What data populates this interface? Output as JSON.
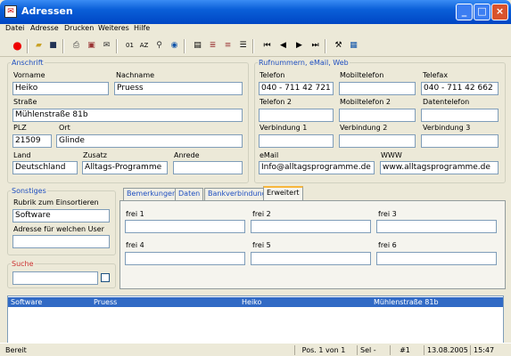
{
  "window": {
    "title": "Adressen",
    "app_icon": "address-book-icon"
  },
  "menu": [
    "Datei",
    "Adresse",
    "Drucken",
    "Weiteres",
    "Hilfe"
  ],
  "anschrift": {
    "legend": "Anschrift",
    "vorname_label": "Vorname",
    "vorname": "Heiko",
    "nachname_label": "Nachname",
    "nachname": "Pruess",
    "strasse_label": "Straße",
    "strasse": "Mühlenstraße 81b",
    "plz_label": "PLZ",
    "plz": "21509",
    "ort_label": "Ort",
    "ort": "Glinde",
    "land_label": "Land",
    "land": "Deutschland",
    "zusatz_label": "Zusatz",
    "zusatz": "Alltags-Programme",
    "anrede_label": "Anrede",
    "anrede": ""
  },
  "rufnummern": {
    "legend": "Rufnummern, eMail, Web",
    "telefon_label": "Telefon",
    "telefon": "040 - 711 42 721",
    "mobil_label": "Mobiltelefon",
    "mobil": "",
    "fax_label": "Telefax",
    "fax": "040 - 711 42 662",
    "telefon2_label": "Telefon 2",
    "telefon2": "",
    "mobil2_label": "Mobiltelefon 2",
    "mobil2": "",
    "daten_label": "Datentelefon",
    "daten": "",
    "verb1_label": "Verbindung 1",
    "verb1": "",
    "verb2_label": "Verbindung 2",
    "verb2": "",
    "verb3_label": "Verbindung 3",
    "verb3": "",
    "email_label": "eMail",
    "email": "Info@alltagsprogramme.de",
    "www_label": "WWW",
    "www": "www.alltagsprogramme.de"
  },
  "sonstiges": {
    "legend": "Sonstiges",
    "rubrik_label": "Rubrik zum Einsortieren",
    "rubrik": "Software",
    "user_label": "Adresse für welchen User",
    "user": ""
  },
  "suche": {
    "legend": "Suche",
    "value": ""
  },
  "tabs": [
    "Bemerkungen",
    "Daten",
    "Bankverbindung",
    "Erweitert"
  ],
  "frei": [
    {
      "label": "frei 1",
      "value": ""
    },
    {
      "label": "frei 2",
      "value": ""
    },
    {
      "label": "frei 3",
      "value": ""
    },
    {
      "label": "frei 4",
      "value": ""
    },
    {
      "label": "frei 5",
      "value": ""
    },
    {
      "label": "frei 6",
      "value": ""
    }
  ],
  "grid_row": [
    "Software",
    "Pruess",
    "Heiko",
    "Mühlenstraße 81b"
  ],
  "status": {
    "text": "Bereit",
    "pos": "Pos. 1 von 1",
    "sel": "Sel -",
    "num": "#1",
    "date": "13.08.2005",
    "time": "15:47"
  },
  "colors": {
    "legend": "#1f4fc0",
    "selection": "#316ac5",
    "title": "#0a5fd8"
  }
}
